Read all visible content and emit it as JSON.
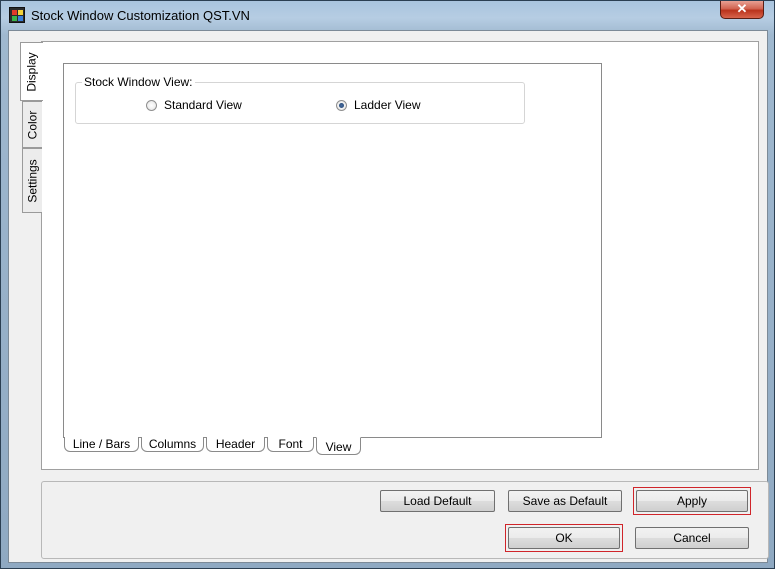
{
  "window": {
    "title": "Stock Window Customization QST.VN",
    "close_icon": "close-icon"
  },
  "side_tabs": [
    {
      "label": "Display",
      "active": true
    },
    {
      "label": "Color",
      "active": false
    },
    {
      "label": "Settings",
      "active": false
    }
  ],
  "group": {
    "label": "Stock Window View:",
    "options": [
      {
        "label": "Standard View",
        "checked": false
      },
      {
        "label": "Ladder View",
        "checked": true
      }
    ]
  },
  "bottom_tabs": [
    {
      "label": "Line / Bars",
      "active": false
    },
    {
      "label": "Columns",
      "active": false
    },
    {
      "label": "Header",
      "active": false
    },
    {
      "label": "Font",
      "active": false
    },
    {
      "label": "View",
      "active": true
    }
  ],
  "buttons": {
    "load_default": "Load Default",
    "save_default": "Save as Default",
    "apply": "Apply",
    "ok": "OK",
    "cancel": "Cancel"
  },
  "colors": {
    "highlight": "#d0252a",
    "accent": "#1d3f6e"
  }
}
